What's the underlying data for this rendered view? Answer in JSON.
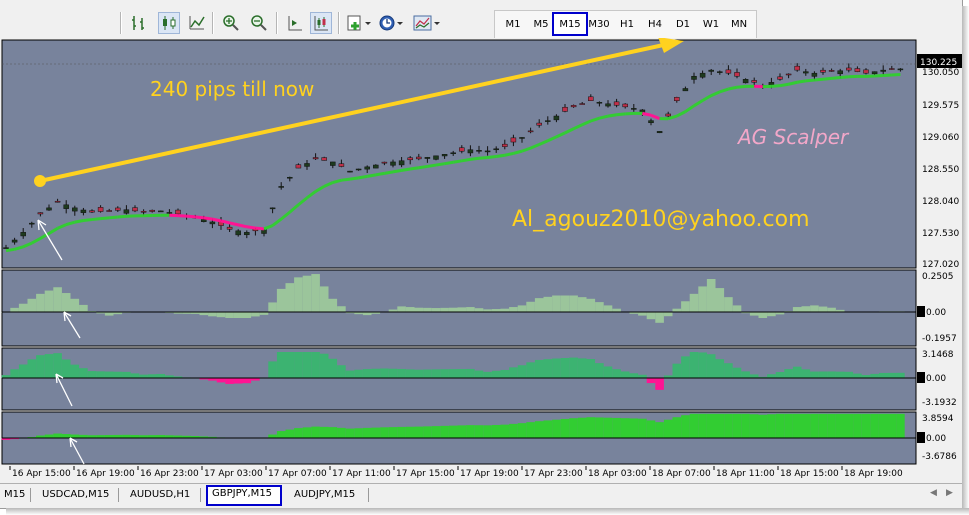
{
  "toolbar": {
    "icons": [
      "bar-chart-icon",
      "candlestick-icon",
      "line-chart-icon",
      "zoom-in-icon",
      "zoom-out-icon",
      "chart-shift-icon",
      "autoscroll-icon",
      "indicators-icon",
      "periods-icon",
      "templates-icon"
    ],
    "timeframes": [
      "M1",
      "M5",
      "M15",
      "M30",
      "H1",
      "H4",
      "D1",
      "W1",
      "MN"
    ],
    "active_timeframe": "M15"
  },
  "chart": {
    "annotation_pips": "240 pips till now",
    "annotation_name": "AG Scalper",
    "annotation_email": "Al_agouz2010@yahoo.com",
    "current_price": "130.225",
    "colors": {
      "background": "#78839c",
      "candle_up": "#1e3a1e",
      "signal_green": "#33cc33",
      "signal_pink": "#ff1493",
      "arrow_yellow": "#ffd21f",
      "osc1_fill": "#9bc59b",
      "osc2_fill": "#3cb371",
      "osc3_fill": "#32cd32"
    }
  },
  "chart_data": {
    "type": "line",
    "title": "",
    "symbol": "GBPJPY",
    "timeframe": "M15",
    "price_axis_ticks": [
      "130.050",
      "129.575",
      "129.060",
      "128.550",
      "128.040",
      "127.530",
      "127.020"
    ],
    "time_axis_ticks": [
      "16 Apr 15:00",
      "16 Apr 19:00",
      "16 Apr 23:00",
      "17 Apr 03:00",
      "17 Apr 07:00",
      "17 Apr 11:00",
      "17 Apr 15:00",
      "17 Apr 19:00",
      "17 Apr 23:00",
      "18 Apr 03:00",
      "18 Apr 07:00",
      "18 Apr 11:00",
      "18 Apr 15:00",
      "18 Apr 19:00"
    ],
    "price_points": [
      [
        0,
        127.3
      ],
      [
        2,
        127.55
      ],
      [
        4,
        127.85
      ],
      [
        6,
        128.05
      ],
      [
        8,
        127.95
      ],
      [
        10,
        127.88
      ],
      [
        12,
        127.9
      ],
      [
        14,
        127.92
      ],
      [
        16,
        127.88
      ],
      [
        18,
        127.9
      ],
      [
        20,
        127.85
      ],
      [
        22,
        127.8
      ],
      [
        24,
        127.72
      ],
      [
        26,
        127.6
      ],
      [
        28,
        127.55
      ],
      [
        30,
        127.6
      ],
      [
        32,
        128.3
      ],
      [
        34,
        128.6
      ],
      [
        36,
        128.75
      ],
      [
        38,
        128.7
      ],
      [
        40,
        128.55
      ],
      [
        42,
        128.62
      ],
      [
        44,
        128.68
      ],
      [
        46,
        128.72
      ],
      [
        48,
        128.75
      ],
      [
        50,
        128.8
      ],
      [
        52,
        128.85
      ],
      [
        54,
        128.9
      ],
      [
        56,
        128.88
      ],
      [
        58,
        128.95
      ],
      [
        60,
        129.1
      ],
      [
        62,
        129.3
      ],
      [
        64,
        129.45
      ],
      [
        66,
        129.6
      ],
      [
        68,
        129.7
      ],
      [
        70,
        129.65
      ],
      [
        72,
        129.6
      ],
      [
        74,
        129.55
      ],
      [
        76,
        129.2
      ],
      [
        78,
        129.7
      ],
      [
        80,
        130.1
      ],
      [
        82,
        130.2
      ],
      [
        84,
        130.15
      ],
      [
        86,
        130.05
      ],
      [
        88,
        129.95
      ],
      [
        90,
        130.05
      ],
      [
        92,
        130.2
      ],
      [
        94,
        130.15
      ],
      [
        96,
        130.18
      ],
      [
        98,
        130.2
      ],
      [
        100,
        130.15
      ],
      [
        102,
        130.2
      ],
      [
        104,
        130.22
      ]
    ],
    "osc1_axis": [
      "0.2505",
      "0.00",
      "-0.1957"
    ],
    "osc2_axis": [
      "3.1468",
      "0.00",
      "-3.1932"
    ],
    "osc3_axis": [
      "3.8594",
      "0.00",
      "-3.6786"
    ]
  },
  "tabs": {
    "items": [
      "M15",
      "USDCAD,M15",
      "AUDUSD,H1",
      "GBPJPY,M15",
      "AUDJPY,M15"
    ],
    "active": "GBPJPY,M15"
  }
}
